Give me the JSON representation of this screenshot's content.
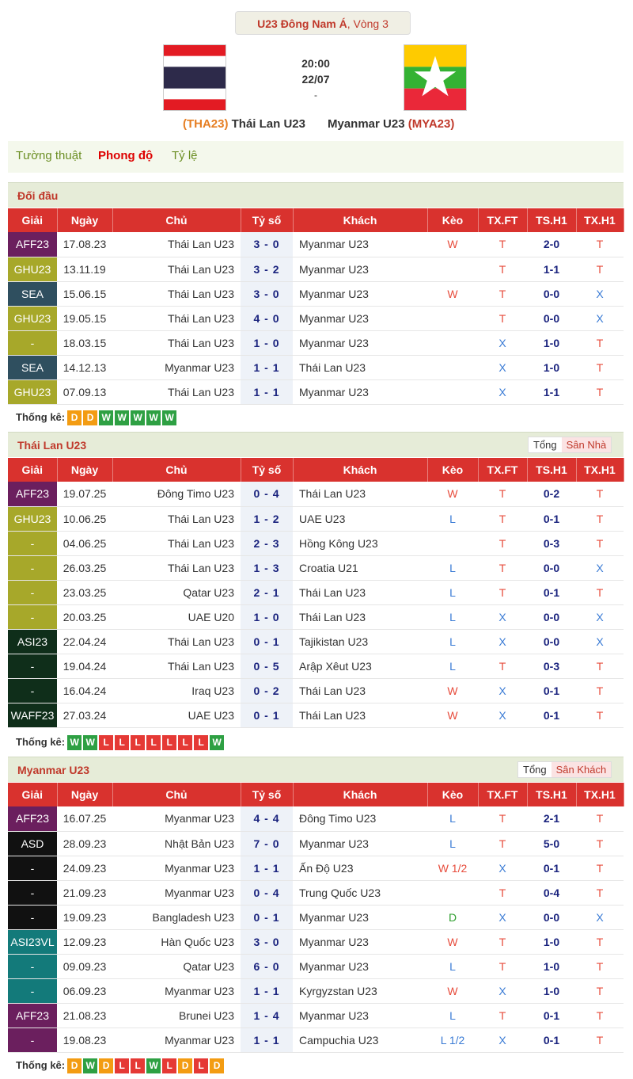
{
  "header": {
    "league": "U23 Đông Nam Á",
    "round": ", Vòng 3",
    "time": "20:00",
    "date": "22/07",
    "score": "-",
    "home_code": "(THA23)",
    "home_name": " Thái Lan U23",
    "away_name": "Myanmar U23 ",
    "away_code": "(MYA23)"
  },
  "tabs": [
    "Tường thuật",
    "Phong độ",
    "Tỷ lệ"
  ],
  "columns": [
    "Giải",
    "Ngày",
    "Chủ",
    "Tỷ số",
    "Khách",
    "Kèo",
    "TX.FT",
    "TS.H1",
    "TX.H1"
  ],
  "stats_label": "Thống kê:",
  "h2h": {
    "title": "Đối đầu",
    "rows": [
      {
        "lg": "AFF23",
        "lgc": "#6b1f5e",
        "d": "17.08.23",
        "h": "Thái Lan U23",
        "s": "3 - 0",
        "a": "Myanmar U23",
        "k": "W",
        "ft": "T",
        "h1": "2-0",
        "tx": "T"
      },
      {
        "lg": "GHU23",
        "lgc": "#a7a82a",
        "d": "13.11.19",
        "h": "Thái Lan U23",
        "s": "3 - 2",
        "a": "Myanmar U23",
        "k": "",
        "ft": "T",
        "h1": "1-1",
        "tx": "T"
      },
      {
        "lg": "SEA",
        "lgc": "#2f4f5f",
        "d": "15.06.15",
        "h": "Thái Lan U23",
        "s": "3 - 0",
        "a": "Myanmar U23",
        "k": "W",
        "ft": "T",
        "h1": "0-0",
        "tx": "X"
      },
      {
        "lg": "GHU23",
        "lgc": "#a7a82a",
        "d": "19.05.15",
        "h": "Thái Lan U23",
        "s": "4 - 0",
        "a": "Myanmar U23",
        "k": "",
        "ft": "T",
        "h1": "0-0",
        "tx": "X"
      },
      {
        "lg": "-",
        "lgc": "#a7a82a",
        "d": "18.03.15",
        "h": "Thái Lan U23",
        "s": "1 - 0",
        "a": "Myanmar U23",
        "k": "",
        "ft": "X",
        "h1": "1-0",
        "tx": "T"
      },
      {
        "lg": "SEA",
        "lgc": "#2f4f5f",
        "d": "14.12.13",
        "h": "Myanmar U23",
        "s": "1 - 1",
        "a": "Thái Lan U23",
        "k": "",
        "ft": "X",
        "h1": "1-0",
        "tx": "T"
      },
      {
        "lg": "GHU23",
        "lgc": "#a7a82a",
        "d": "07.09.13",
        "h": "Thái Lan U23",
        "s": "1 - 1",
        "a": "Myanmar U23",
        "k": "",
        "ft": "X",
        "h1": "1-1",
        "tx": "T"
      }
    ],
    "form": [
      "D",
      "D",
      "W",
      "W",
      "W",
      "W",
      "W"
    ]
  },
  "home": {
    "title": "Thái Lan U23",
    "switch": [
      "Tổng",
      "Sân Nhà"
    ],
    "rows": [
      {
        "lg": "AFF23",
        "lgc": "#6b1f5e",
        "d": "19.07.25",
        "h": "Đông Timo U23",
        "s": "0 - 4",
        "a": "Thái Lan U23",
        "k": "W",
        "ft": "T",
        "h1": "0-2",
        "tx": "T"
      },
      {
        "lg": "GHU23",
        "lgc": "#a7a82a",
        "d": "10.06.25",
        "h": "Thái Lan U23",
        "s": "1 - 2",
        "a": "UAE U23",
        "k": "L",
        "ft": "T",
        "h1": "0-1",
        "tx": "T"
      },
      {
        "lg": "-",
        "lgc": "#a7a82a",
        "d": "04.06.25",
        "h": "Thái Lan U23",
        "s": "2 - 3",
        "a": "Hồng Kông U23",
        "k": "",
        "ft": "T",
        "h1": "0-3",
        "tx": "T"
      },
      {
        "lg": "-",
        "lgc": "#a7a82a",
        "d": "26.03.25",
        "h": "Thái Lan U23",
        "s": "1 - 3",
        "a": "Croatia U21",
        "k": "L",
        "ft": "T",
        "h1": "0-0",
        "tx": "X"
      },
      {
        "lg": "-",
        "lgc": "#a7a82a",
        "d": "23.03.25",
        "h": "Qatar U23",
        "s": "2 - 1",
        "a": "Thái Lan U23",
        "k": "L",
        "ft": "T",
        "h1": "0-1",
        "tx": "T"
      },
      {
        "lg": "-",
        "lgc": "#a7a82a",
        "d": "20.03.25",
        "h": "UAE U20",
        "s": "1 - 0",
        "a": "Thái Lan U23",
        "k": "L",
        "ft": "X",
        "h1": "0-0",
        "tx": "X"
      },
      {
        "lg": "ASI23",
        "lgc": "#0f2e1a",
        "d": "22.04.24",
        "h": "Thái Lan U23",
        "s": "0 - 1",
        "a": "Tajikistan U23",
        "k": "L",
        "ft": "X",
        "h1": "0-0",
        "tx": "X"
      },
      {
        "lg": "-",
        "lgc": "#0f2e1a",
        "d": "19.04.24",
        "h": "Thái Lan U23",
        "s": "0 - 5",
        "a": "Arập Xêut U23",
        "k": "L",
        "ft": "T",
        "h1": "0-3",
        "tx": "T"
      },
      {
        "lg": "-",
        "lgc": "#0f2e1a",
        "d": "16.04.24",
        "h": "Iraq U23",
        "s": "0 - 2",
        "a": "Thái Lan U23",
        "k": "W",
        "ft": "X",
        "h1": "0-1",
        "tx": "T"
      },
      {
        "lg": "WAFF23",
        "lgc": "#0f2e1a",
        "d": "27.03.24",
        "h": "UAE U23",
        "s": "0 - 1",
        "a": "Thái Lan U23",
        "k": "W",
        "ft": "X",
        "h1": "0-1",
        "tx": "T"
      }
    ],
    "form": [
      "W",
      "W",
      "L",
      "L",
      "L",
      "L",
      "L",
      "L",
      "L",
      "W"
    ]
  },
  "away": {
    "title": "Myanmar U23",
    "switch": [
      "Tổng",
      "Sân Khách"
    ],
    "rows": [
      {
        "lg": "AFF23",
        "lgc": "#6b1f5e",
        "d": "16.07.25",
        "h": "Myanmar U23",
        "s": "4 - 4",
        "a": "Đông Timo U23",
        "k": "L",
        "ft": "T",
        "h1": "2-1",
        "tx": "T"
      },
      {
        "lg": "ASD",
        "lgc": "#111111",
        "d": "28.09.23",
        "h": "Nhật Bản U23",
        "s": "7 - 0",
        "a": "Myanmar U23",
        "k": "L",
        "ft": "T",
        "h1": "5-0",
        "tx": "T"
      },
      {
        "lg": "-",
        "lgc": "#111111",
        "d": "24.09.23",
        "h": "Myanmar U23",
        "s": "1 - 1",
        "a": "Ấn Độ U23",
        "k": "W 1/2",
        "ft": "X",
        "h1": "0-1",
        "tx": "T"
      },
      {
        "lg": "-",
        "lgc": "#111111",
        "d": "21.09.23",
        "h": "Myanmar U23",
        "s": "0 - 4",
        "a": "Trung Quốc U23",
        "k": "",
        "ft": "T",
        "h1": "0-4",
        "tx": "T"
      },
      {
        "lg": "-",
        "lgc": "#111111",
        "d": "19.09.23",
        "h": "Bangladesh U23",
        "s": "0 - 1",
        "a": "Myanmar U23",
        "k": "D",
        "ft": "X",
        "h1": "0-0",
        "tx": "X"
      },
      {
        "lg": "ASI23VL",
        "lgc": "#137a7a",
        "d": "12.09.23",
        "h": "Hàn Quốc U23",
        "s": "3 - 0",
        "a": "Myanmar U23",
        "k": "W",
        "ft": "T",
        "h1": "1-0",
        "tx": "T"
      },
      {
        "lg": "-",
        "lgc": "#137a7a",
        "d": "09.09.23",
        "h": "Qatar U23",
        "s": "6 - 0",
        "a": "Myanmar U23",
        "k": "L",
        "ft": "T",
        "h1": "1-0",
        "tx": "T"
      },
      {
        "lg": "-",
        "lgc": "#137a7a",
        "d": "06.09.23",
        "h": "Myanmar U23",
        "s": "1 - 1",
        "a": "Kyrgyzstan U23",
        "k": "W",
        "ft": "X",
        "h1": "1-0",
        "tx": "T"
      },
      {
        "lg": "AFF23",
        "lgc": "#6b1f5e",
        "d": "21.08.23",
        "h": "Brunei U23",
        "s": "1 - 4",
        "a": "Myanmar U23",
        "k": "L",
        "ft": "T",
        "h1": "0-1",
        "tx": "T"
      },
      {
        "lg": "-",
        "lgc": "#6b1f5e",
        "d": "19.08.23",
        "h": "Myanmar U23",
        "s": "1 - 1",
        "a": "Campuchia U23",
        "k": "L 1/2",
        "ft": "X",
        "h1": "0-1",
        "tx": "T"
      }
    ],
    "form": [
      "D",
      "W",
      "D",
      "L",
      "L",
      "W",
      "L",
      "D",
      "L",
      "D"
    ]
  },
  "colors": {
    "header_red": "#d9322e",
    "win": "#2ea043",
    "draw": "#f39c12",
    "loss": "#e53935"
  }
}
